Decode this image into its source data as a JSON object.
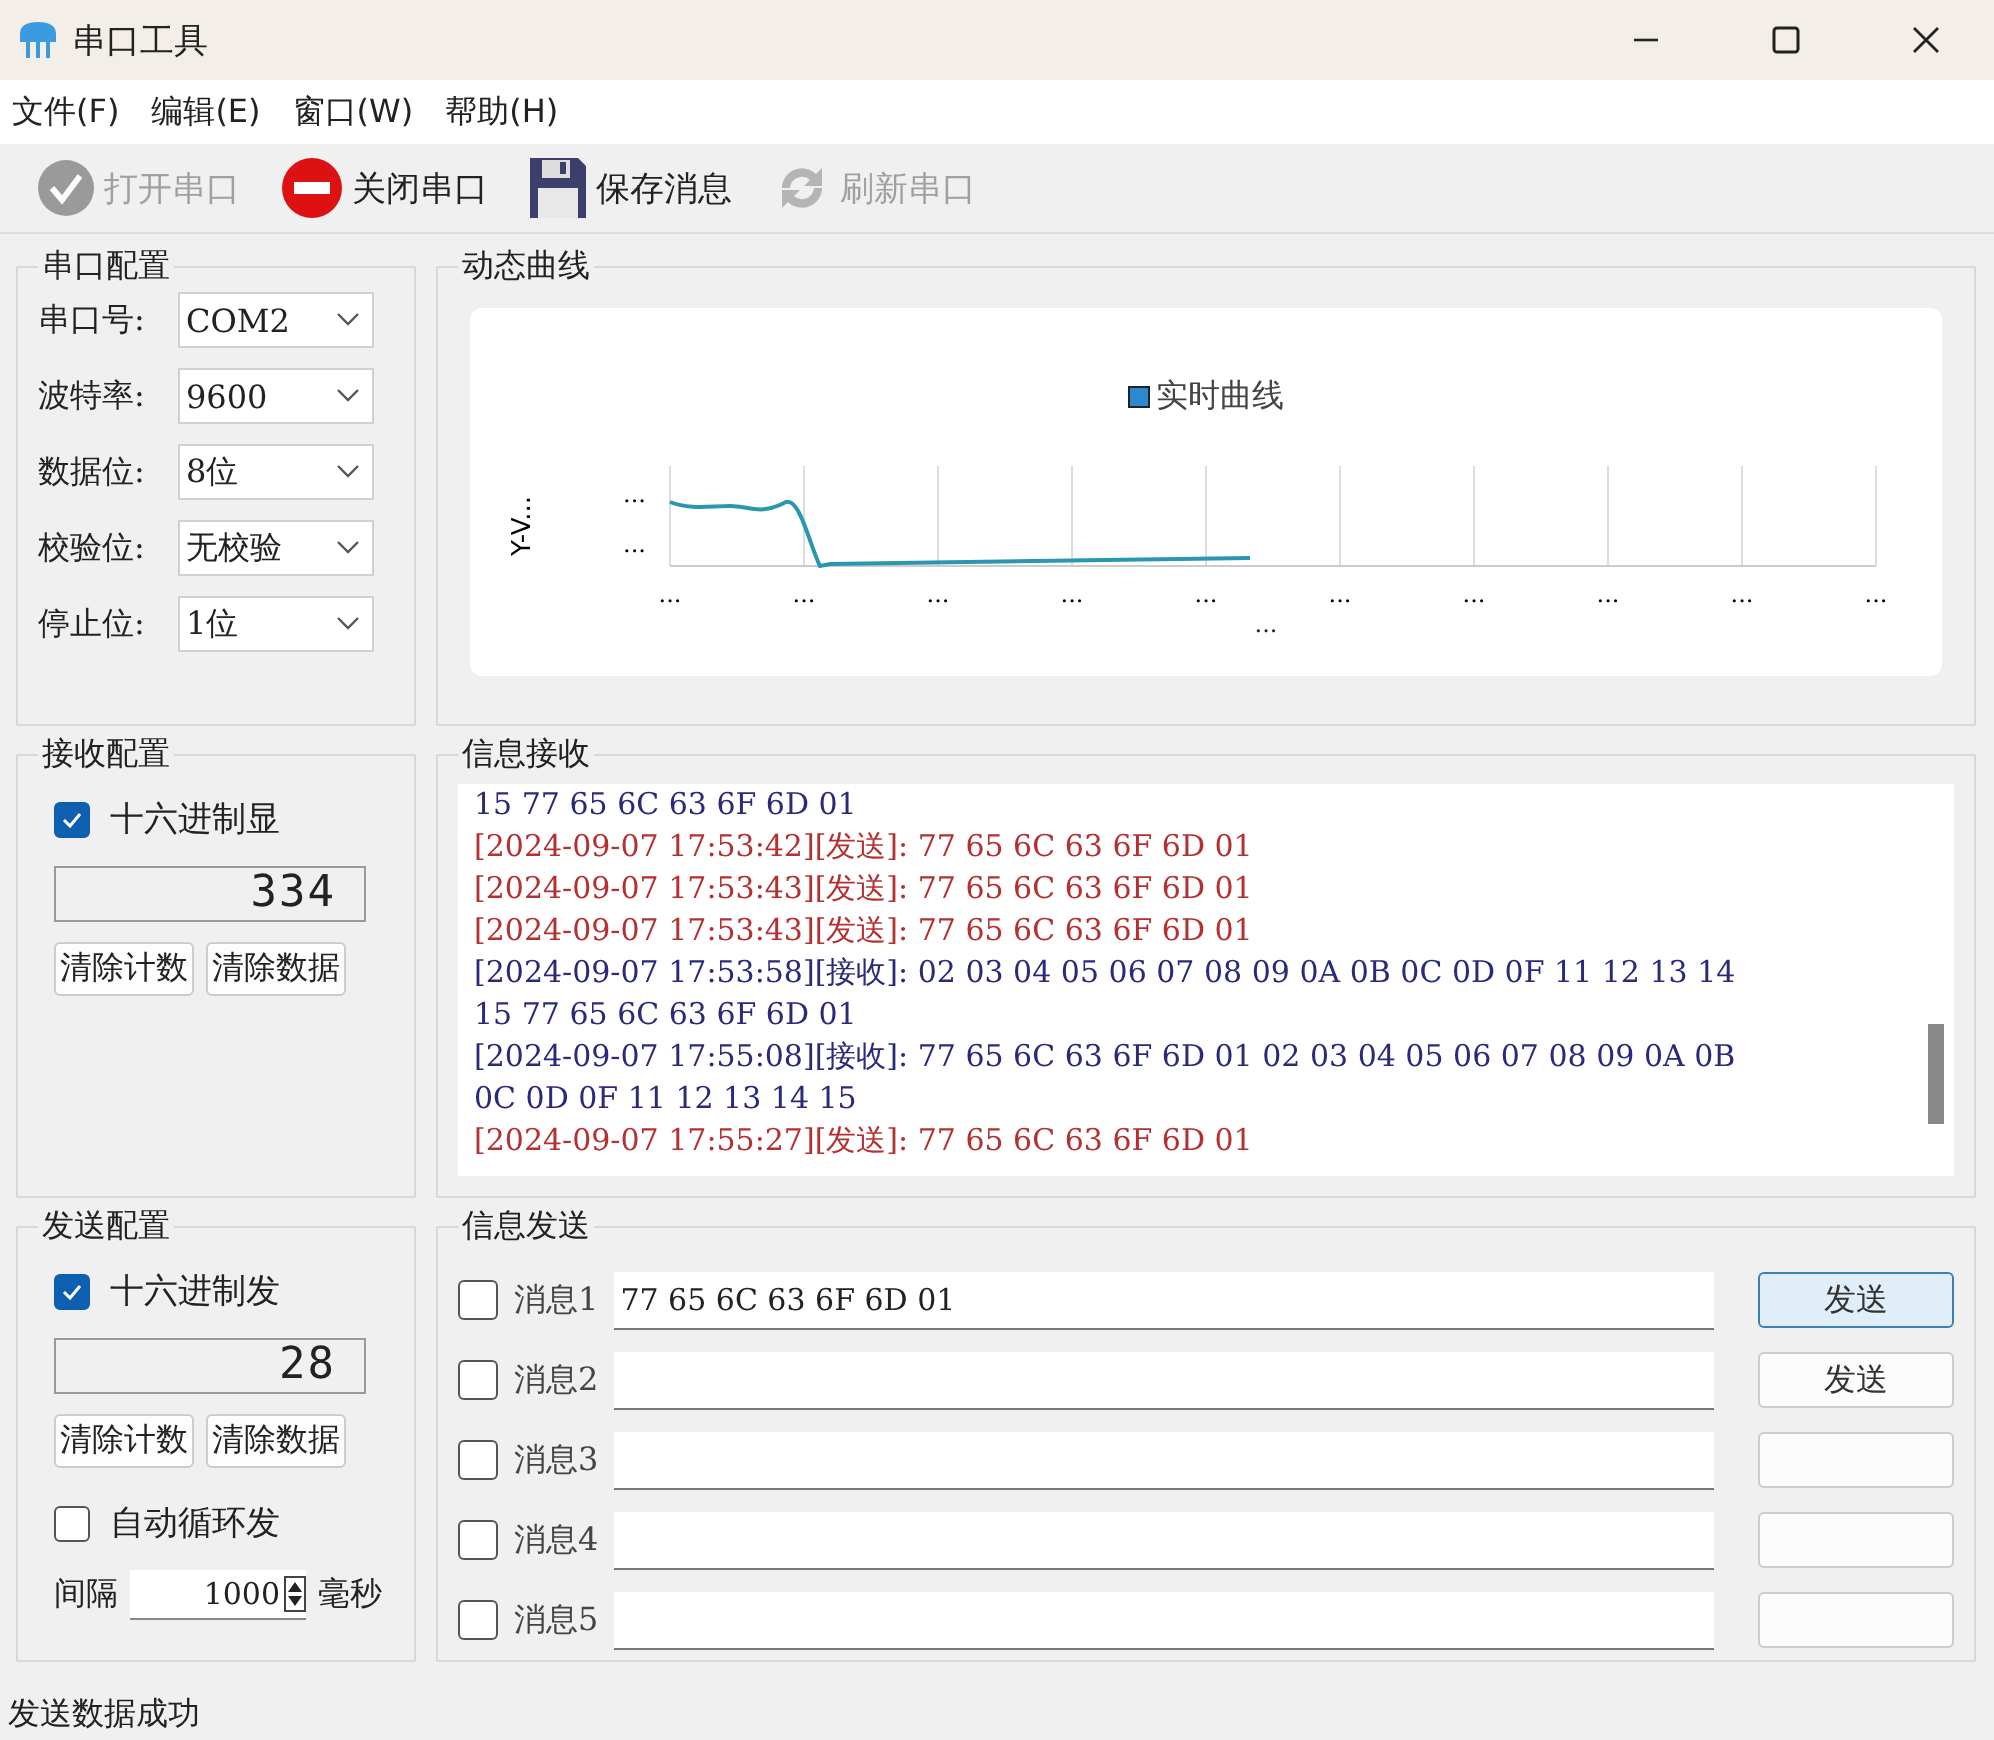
{
  "window": {
    "title": "串口工具"
  },
  "menu": [
    "文件(F)",
    "编辑(E)",
    "窗口(W)",
    "帮助(H)"
  ],
  "toolbar": [
    {
      "kind": "open",
      "label": "打开串口",
      "disabled": true
    },
    {
      "kind": "close",
      "label": "关闭串口",
      "disabled": false
    },
    {
      "kind": "save",
      "label": "保存消息",
      "disabled": false
    },
    {
      "kind": "refresh",
      "label": "刷新串口",
      "disabled": true
    }
  ],
  "port_config": {
    "title": "串口配置",
    "fields": [
      {
        "label": "串口号:",
        "value": "COM2"
      },
      {
        "label": "波特率:",
        "value": "9600"
      },
      {
        "label": "数据位:",
        "value": "8位"
      },
      {
        "label": "校验位:",
        "value": "无校验"
      },
      {
        "label": "停止位:",
        "value": "1位"
      }
    ]
  },
  "curve": {
    "title": "动态曲线",
    "legend": "实时曲线",
    "y_axis_label": "Y-V...",
    "y_ticks": [
      "...",
      "..."
    ],
    "x_ticks": [
      "...",
      "...",
      "...",
      "...",
      "...",
      "...",
      "...",
      "...",
      "...",
      "..."
    ],
    "x_axis_label": "..."
  },
  "receive_config": {
    "title": "接收配置",
    "hex": {
      "label": "十六进制显",
      "checked": true
    },
    "counter": "334",
    "buttons": [
      "清除计数",
      "清除数据"
    ]
  },
  "receive_log": {
    "title": "信息接收",
    "lines": [
      {
        "kind": "receive",
        "text": "15 77 65 6C 63 6F 6D 01"
      },
      {
        "kind": "send",
        "text": "[2024-09-07 17:53:42][发送]: 77 65 6C 63 6F 6D 01"
      },
      {
        "kind": "send",
        "text": "[2024-09-07 17:53:43][发送]: 77 65 6C 63 6F 6D 01"
      },
      {
        "kind": "send",
        "text": "[2024-09-07 17:53:43][发送]: 77 65 6C 63 6F 6D 01"
      },
      {
        "kind": "receive",
        "text": "[2024-09-07 17:53:58][接收]: 02 03 04 05 06 07 08 09 0A 0B 0C 0D 0F 11 12 13 14"
      },
      {
        "kind": "receive",
        "text": "15 77 65 6C 63 6F 6D 01"
      },
      {
        "kind": "receive",
        "text": "[2024-09-07 17:55:08][接收]: 77 65 6C 63 6F 6D 01 02 03 04 05 06 07 08 09 0A 0B"
      },
      {
        "kind": "receive",
        "text": "0C 0D 0F 11 12 13 14 15"
      },
      {
        "kind": "send",
        "text": "[2024-09-07 17:55:27][发送]: 77 65 6C 63 6F 6D 01"
      }
    ]
  },
  "send_config": {
    "title": "发送配置",
    "hex": {
      "label": "十六进制发",
      "checked": true
    },
    "counter": "28",
    "buttons": [
      "清除计数",
      "清除数据"
    ],
    "auto_loop": {
      "label": "自动循环发",
      "checked": false
    },
    "interval_label": "间隔",
    "interval": "1000",
    "unit": "毫秒"
  },
  "send_messages": {
    "title": "信息发送",
    "messages": [
      {
        "label": "消息1",
        "checked": false,
        "value": "77 65 6C 63 6F 6D 01",
        "send_button": "发送",
        "selected": true
      },
      {
        "label": "消息2",
        "checked": false,
        "send_button": "发送",
        "selected": false
      },
      {
        "label": "消息3",
        "checked": false,
        "selected": false
      },
      {
        "label": "消息4",
        "checked": false,
        "selected": false
      },
      {
        "label": "消息5",
        "checked": false,
        "selected": false
      }
    ]
  },
  "status_bar": "发送数据成功"
}
